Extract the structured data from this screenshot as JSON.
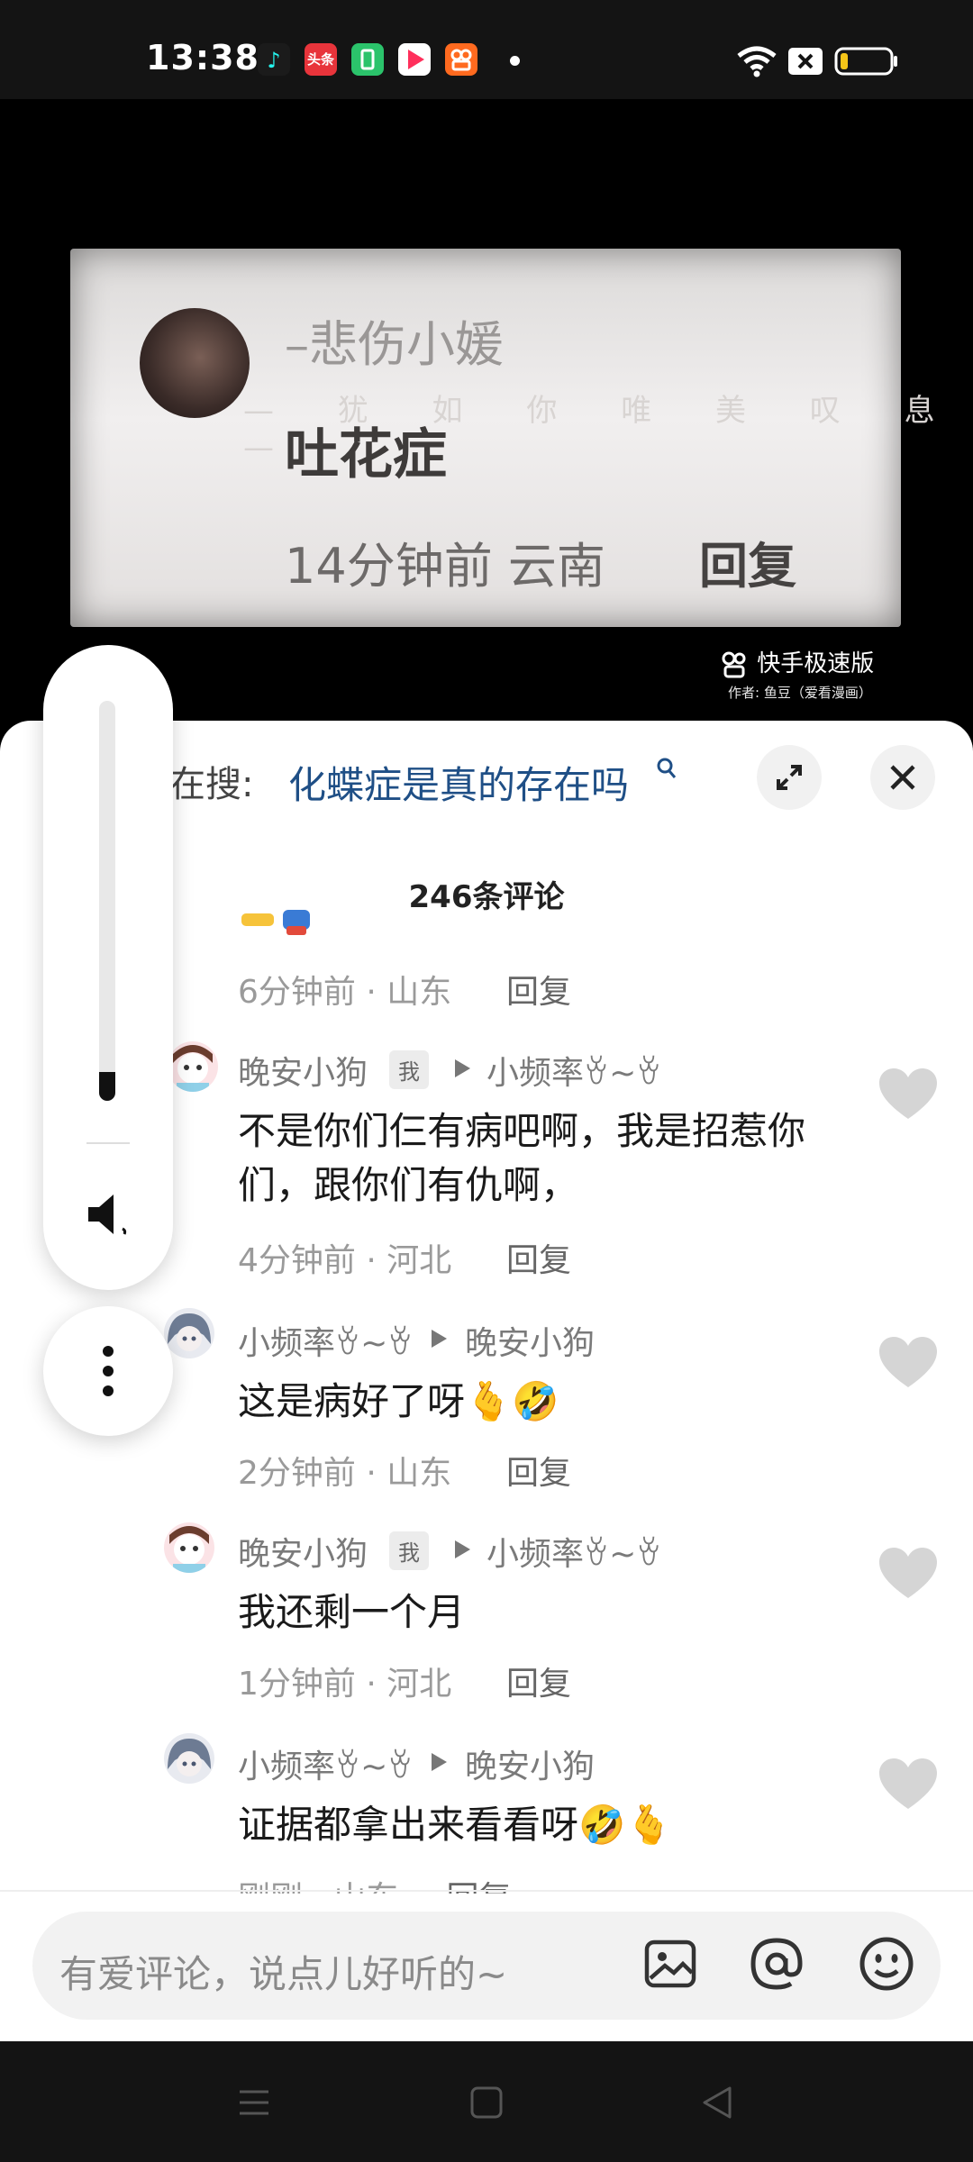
{
  "status_bar": {
    "time": "13:38",
    "apps": [
      {
        "icon": "douyin-lite-icon",
        "label": "",
        "color": "#1b1b1b"
      },
      {
        "icon": "toutiao-icon",
        "label": "头条",
        "color": "#e8343b"
      },
      {
        "icon": "battery-app-icon",
        "label": "",
        "color": "#2bc36b"
      },
      {
        "icon": "video-app-icon",
        "label": "",
        "color": "#ff2f5b"
      },
      {
        "icon": "kuaishou-icon",
        "label": "",
        "color": "#ff6a1f"
      }
    ],
    "battery_level": 0.15
  },
  "video": {
    "user_name": "–悲伤小媛",
    "signature": "— 犹 如 你 唯 美 叹 息 —",
    "title": "吐花症",
    "meta": "14分钟前 云南",
    "reply": "回复",
    "watermark": "快手极速版",
    "author": "作者: 鱼豆（爱看漫画）"
  },
  "search": {
    "prefix": "在搜:",
    "query": "化蝶症是真的存在吗"
  },
  "comments_header": {
    "count_label": "246条评论"
  },
  "comments": [
    {
      "user": "",
      "meta": "6分钟前 · 山东",
      "reply": "回复"
    },
    {
      "user": "晚安小狗",
      "badge": "我",
      "reply_to": "小频率ꈊ~ꈊ",
      "text": "不是你们仨有病吧啊，我是招惹你们，跟你们有仇啊，",
      "meta": "4分钟前 · 河北",
      "reply": "回复"
    },
    {
      "user": "小频率ꈊ~ꈊ",
      "reply_to": "晚安小狗",
      "text": "这是病好了呀🫰🤣",
      "meta": "2分钟前 · 山东",
      "reply": "回复"
    },
    {
      "user": "晚安小狗",
      "badge": "我",
      "reply_to": "小频率ꈊ~ꈊ",
      "text": "我还剩一个月",
      "meta": "1分钟前 · 河北",
      "reply": "回复"
    },
    {
      "user": "小频率ꈊ~ꈊ",
      "reply_to": "晚安小狗",
      "text": "证据都拿出来看看呀🤣🫰",
      "meta": "刚刚 · 山东",
      "reply": "回复"
    }
  ],
  "input": {
    "placeholder": "有爱评论，说点儿好听的~"
  },
  "volume": {
    "level": 0.07
  }
}
